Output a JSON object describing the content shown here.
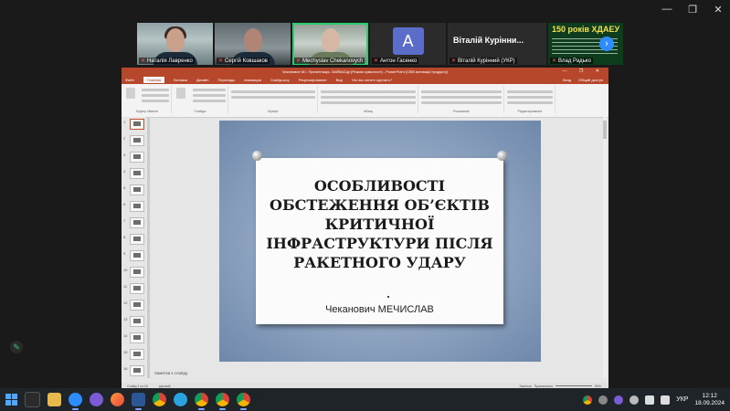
{
  "window": {
    "minimize": "—",
    "restore": "❐",
    "close": "✕"
  },
  "participants": [
    {
      "name": "Наталія Лавренко",
      "muted": true
    },
    {
      "name": "Сергій Ковшаков",
      "muted": true
    },
    {
      "name": "Mechyslav Chekanovych",
      "muted": true,
      "active_speaker": true
    },
    {
      "name": "Антон Гасенко",
      "initial": "A",
      "muted": true
    },
    {
      "name": "Віталій Курінний (УКР)",
      "display": "Віталій Курінни...",
      "muted": true
    },
    {
      "name": "Влад Радько",
      "banner": "150 років ХДАЕУ",
      "muted": true
    }
  ],
  "next_button": "›",
  "powerpoint": {
    "title_bar": "Чекановин М.І. Презентація- ЗАЙКАСіді (Режим сумісності) - PowerPoint (Сбій активації продукту)",
    "window_buttons": "— ❐ ✕",
    "tabs": [
      "Файл",
      "Главная",
      "Вставка",
      "Дизайн",
      "Переходы",
      "Анимация",
      "Слайд-шоу",
      "Рецензирование",
      "Вид",
      "Что вы хотите сделать?"
    ],
    "tabs_right": [
      "Вход",
      "Общий доступ"
    ],
    "ribbon_groups": [
      "Буфер обмена",
      "Слайды",
      "Шрифт",
      "Абзац",
      "Рисование",
      "Редактирование"
    ],
    "slide_numbers": [
      "1",
      "2",
      "3",
      "4",
      "5",
      "6",
      "7",
      "8",
      "9",
      "10",
      "11",
      "12",
      "13",
      "14",
      "15",
      "16"
    ],
    "slide": {
      "title": "ОСОБЛИВОСТІ ОБСТЕЖЕННЯ ОБ’ЄКТІВ КРИТИЧНОЇ ІНФРАСТРУКТУРИ ПІСЛЯ РАКЕТНОГО УДАРУ",
      "author": "Чеканович МЕЧИСЛАВ"
    },
    "notes_placeholder": "Заметки к слайду",
    "status_left": "Слайд 1 из 16",
    "status_lang": "русский",
    "status_notes": "Заметки",
    "status_comments": "Примечания",
    "zoom": "59%"
  },
  "taskbar": {
    "lang": "УКР",
    "time": "12:12",
    "date": "18.09.2024",
    "apps": [
      "explorer",
      "files",
      "zoom",
      "viber",
      "firefox",
      "word",
      "chrome",
      "telegram",
      "chrome",
      "chrome",
      "chrome"
    ]
  }
}
